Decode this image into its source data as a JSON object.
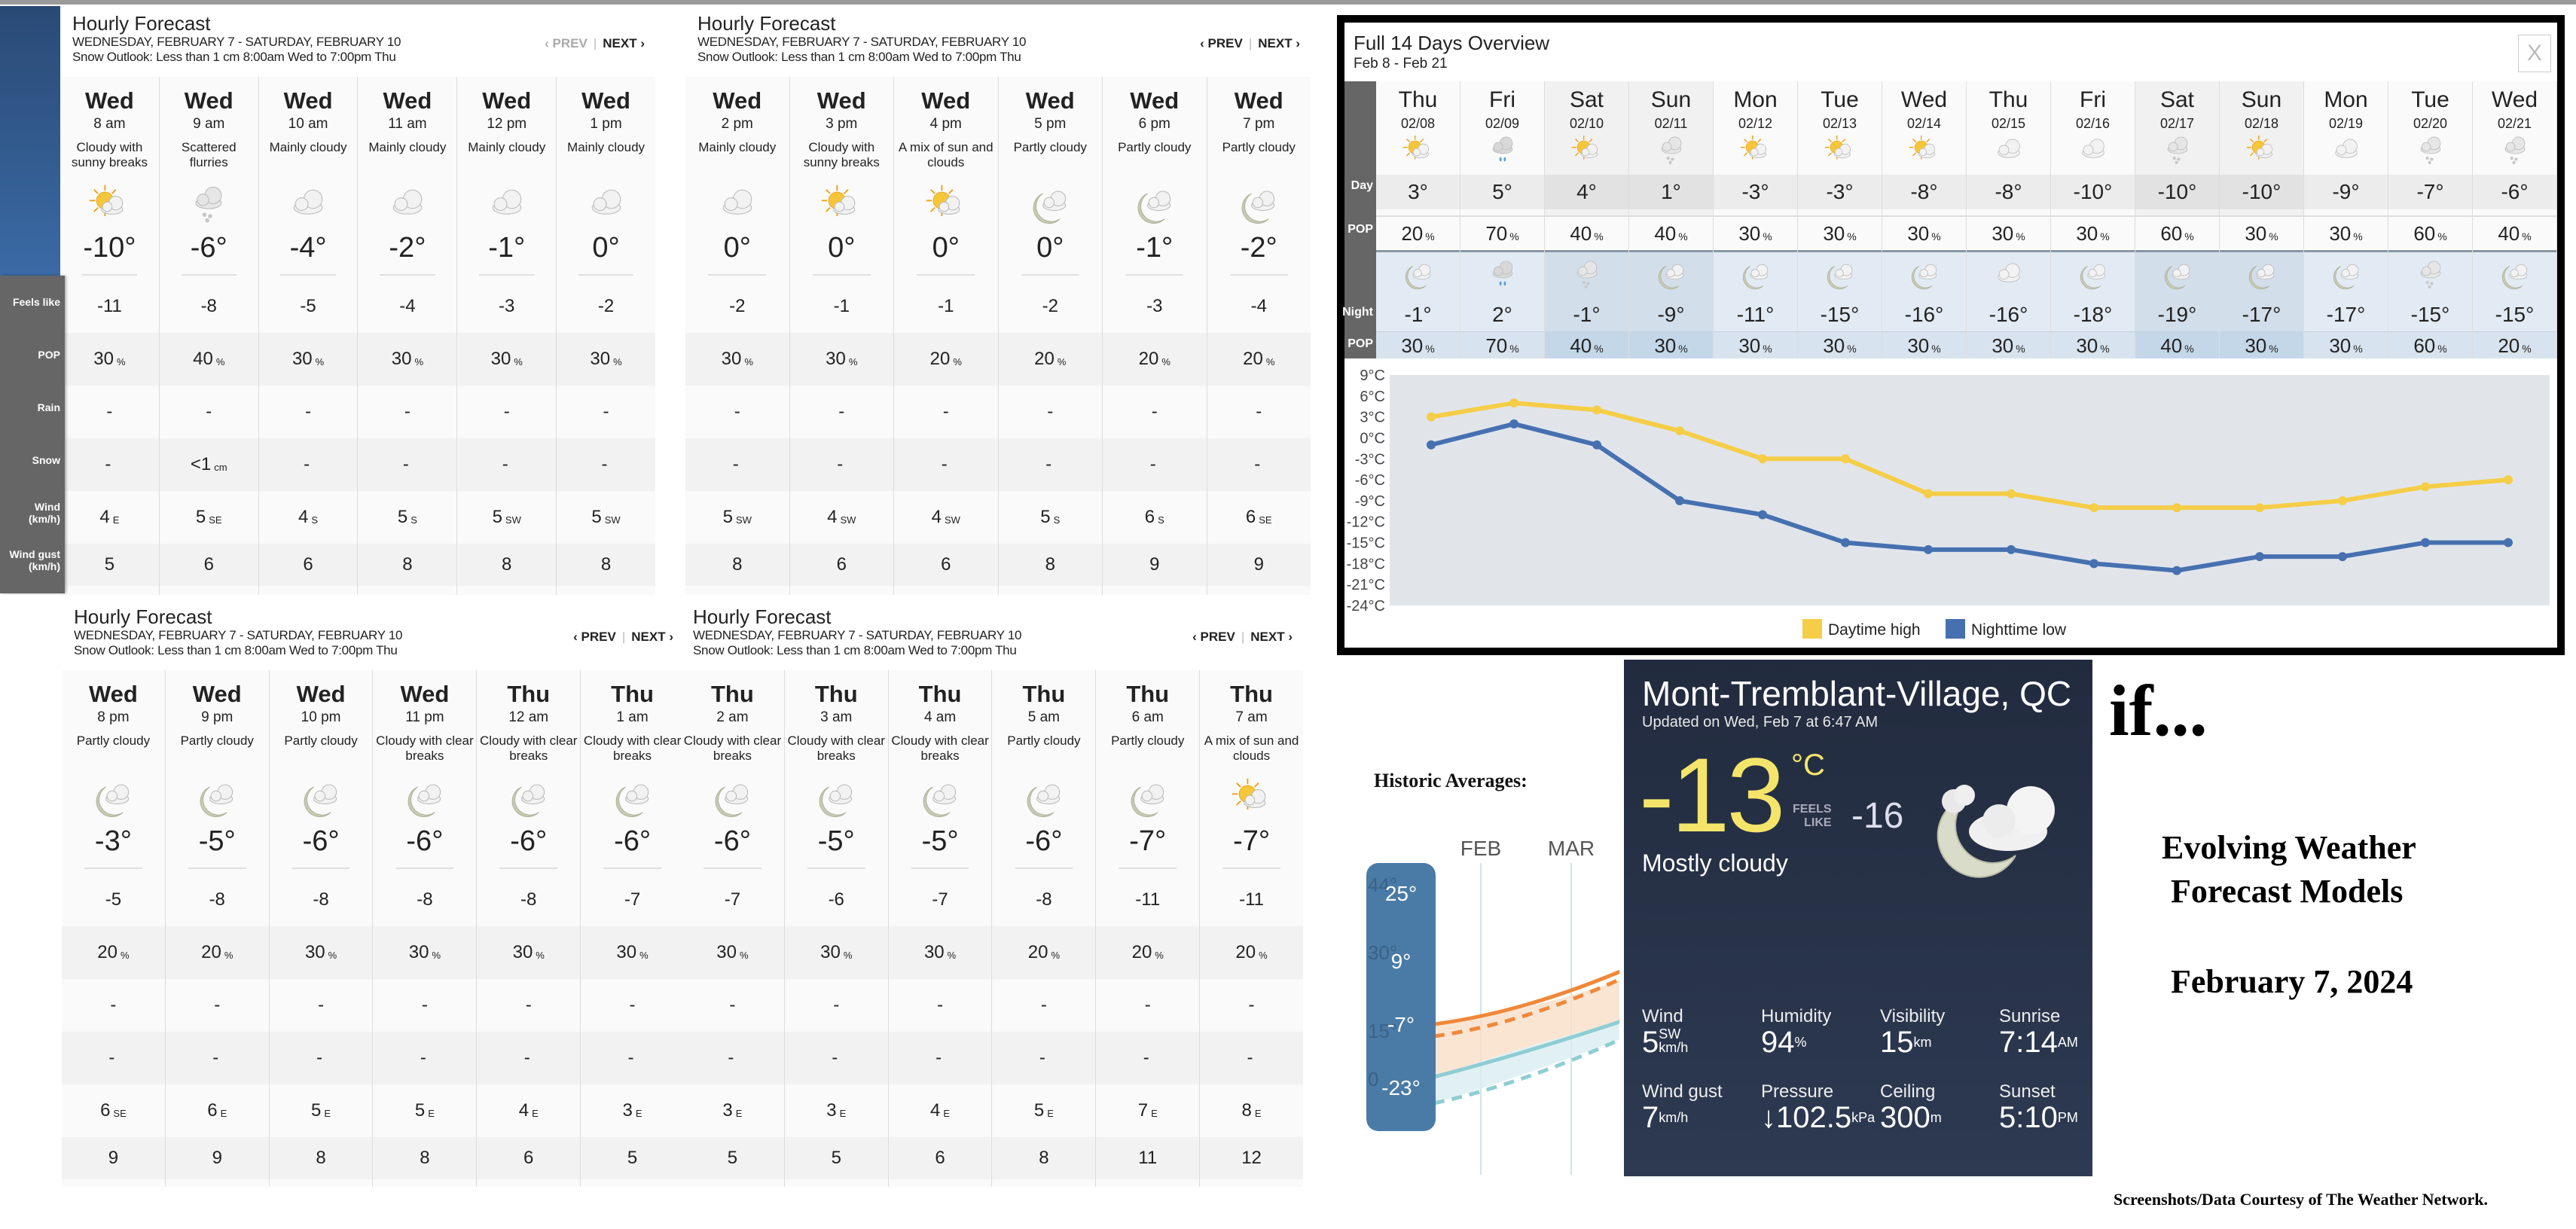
{
  "hourly_panels": [
    {
      "title": "Hourly Forecast",
      "date_range": "WEDNESDAY, FEBRUARY 7 - SATURDAY, FEBRUARY 10",
      "snow_outlook": "Snow Outlook: Less than 1 cm 8:00am Wed to 7:00pm Thu",
      "prev_label": "‹ PREV",
      "next_label": "NEXT ›",
      "prev_disabled": true,
      "hours": [
        {
          "day": "Wed",
          "time": "8 am",
          "condition": "Cloudy with sunny breaks",
          "icon": "sun-cloud",
          "temp": "-10°",
          "feels_like": "-11",
          "pop": "30",
          "rain": "-",
          "snow": "-",
          "snow_unit": "",
          "wind": "4",
          "wind_dir": "E",
          "gust": "5"
        },
        {
          "day": "Wed",
          "time": "9 am",
          "condition": "Scattered flurries",
          "icon": "flurries",
          "temp": "-6°",
          "feels_like": "-8",
          "pop": "40",
          "rain": "-",
          "snow": "<1",
          "snow_unit": "cm",
          "wind": "5",
          "wind_dir": "SE",
          "gust": "6"
        },
        {
          "day": "Wed",
          "time": "10 am",
          "condition": "Mainly cloudy",
          "icon": "cloud",
          "temp": "-4°",
          "feels_like": "-5",
          "pop": "30",
          "rain": "-",
          "snow": "-",
          "snow_unit": "",
          "wind": "4",
          "wind_dir": "S",
          "gust": "6"
        },
        {
          "day": "Wed",
          "time": "11 am",
          "condition": "Mainly cloudy",
          "icon": "cloud",
          "temp": "-2°",
          "feels_like": "-4",
          "pop": "30",
          "rain": "-",
          "snow": "-",
          "snow_unit": "",
          "wind": "5",
          "wind_dir": "S",
          "gust": "8"
        },
        {
          "day": "Wed",
          "time": "12 pm",
          "condition": "Mainly cloudy",
          "icon": "cloud",
          "temp": "-1°",
          "feels_like": "-3",
          "pop": "30",
          "rain": "-",
          "snow": "-",
          "snow_unit": "",
          "wind": "5",
          "wind_dir": "SW",
          "gust": "8"
        },
        {
          "day": "Wed",
          "time": "1 pm",
          "condition": "Mainly cloudy",
          "icon": "cloud",
          "temp": "0°",
          "feels_like": "-2",
          "pop": "30",
          "rain": "-",
          "snow": "-",
          "snow_unit": "",
          "wind": "5",
          "wind_dir": "SW",
          "gust": "8"
        }
      ]
    },
    {
      "title": "Hourly Forecast",
      "date_range": "WEDNESDAY, FEBRUARY 7 - SATURDAY, FEBRUARY 10",
      "snow_outlook": "Snow Outlook: Less than 1 cm 8:00am Wed to 7:00pm Thu",
      "prev_label": "‹ PREV",
      "next_label": "NEXT ›",
      "prev_disabled": false,
      "hours": [
        {
          "day": "Wed",
          "time": "2 pm",
          "condition": "Mainly cloudy",
          "icon": "cloud",
          "temp": "0°",
          "feels_like": "-2",
          "pop": "30",
          "rain": "-",
          "snow": "-",
          "snow_unit": "",
          "wind": "5",
          "wind_dir": "SW",
          "gust": "8"
        },
        {
          "day": "Wed",
          "time": "3 pm",
          "condition": "Cloudy with sunny breaks",
          "icon": "sun-cloud",
          "temp": "0°",
          "feels_like": "-1",
          "pop": "30",
          "rain": "-",
          "snow": "-",
          "snow_unit": "",
          "wind": "4",
          "wind_dir": "SW",
          "gust": "6"
        },
        {
          "day": "Wed",
          "time": "4 pm",
          "condition": "A mix of sun and clouds",
          "icon": "sun-cloud",
          "temp": "0°",
          "feels_like": "-1",
          "pop": "20",
          "rain": "-",
          "snow": "-",
          "snow_unit": "",
          "wind": "4",
          "wind_dir": "SW",
          "gust": "6"
        },
        {
          "day": "Wed",
          "time": "5 pm",
          "condition": "Partly cloudy",
          "icon": "moon-cloud",
          "temp": "0°",
          "feels_like": "-2",
          "pop": "20",
          "rain": "-",
          "snow": "-",
          "snow_unit": "",
          "wind": "5",
          "wind_dir": "S",
          "gust": "8"
        },
        {
          "day": "Wed",
          "time": "6 pm",
          "condition": "Partly cloudy",
          "icon": "moon-cloud",
          "temp": "-1°",
          "feels_like": "-3",
          "pop": "20",
          "rain": "-",
          "snow": "-",
          "snow_unit": "",
          "wind": "6",
          "wind_dir": "S",
          "gust": "9"
        },
        {
          "day": "Wed",
          "time": "7 pm",
          "condition": "Partly cloudy",
          "icon": "moon-cloud",
          "temp": "-2°",
          "feels_like": "-4",
          "pop": "20",
          "rain": "-",
          "snow": "-",
          "snow_unit": "",
          "wind": "6",
          "wind_dir": "SE",
          "gust": "9"
        }
      ]
    },
    {
      "title": "Hourly Forecast",
      "date_range": "WEDNESDAY, FEBRUARY 7 - SATURDAY, FEBRUARY 10",
      "snow_outlook": "Snow Outlook: Less than 1 cm 8:00am Wed to 7:00pm Thu",
      "prev_label": "‹ PREV",
      "next_label": "NEXT ›",
      "prev_disabled": false,
      "hours": [
        {
          "day": "Wed",
          "time": "8 pm",
          "condition": "Partly cloudy",
          "icon": "moon-cloud",
          "temp": "-3°",
          "feels_like": "-5",
          "pop": "20",
          "rain": "-",
          "snow": "-",
          "snow_unit": "",
          "wind": "6",
          "wind_dir": "SE",
          "gust": "9"
        },
        {
          "day": "Wed",
          "time": "9 pm",
          "condition": "Partly cloudy",
          "icon": "moon-cloud",
          "temp": "-5°",
          "feels_like": "-8",
          "pop": "20",
          "rain": "-",
          "snow": "-",
          "snow_unit": "",
          "wind": "6",
          "wind_dir": "E",
          "gust": "9"
        },
        {
          "day": "Wed",
          "time": "10 pm",
          "condition": "Partly cloudy",
          "icon": "moon-cloud",
          "temp": "-6°",
          "feels_like": "-8",
          "pop": "30",
          "rain": "-",
          "snow": "-",
          "snow_unit": "",
          "wind": "5",
          "wind_dir": "E",
          "gust": "8"
        },
        {
          "day": "Wed",
          "time": "11 pm",
          "condition": "Cloudy with clear breaks",
          "icon": "moon-cloud",
          "temp": "-6°",
          "feels_like": "-8",
          "pop": "30",
          "rain": "-",
          "snow": "-",
          "snow_unit": "",
          "wind": "5",
          "wind_dir": "E",
          "gust": "8"
        },
        {
          "day": "Thu",
          "time": "12 am",
          "condition": "Cloudy with clear breaks",
          "icon": "moon-cloud",
          "temp": "-6°",
          "feels_like": "-8",
          "pop": "30",
          "rain": "-",
          "snow": "-",
          "snow_unit": "",
          "wind": "4",
          "wind_dir": "E",
          "gust": "6"
        },
        {
          "day": "Thu",
          "time": "1 am",
          "condition": "Cloudy with clear breaks",
          "icon": "moon-cloud",
          "temp": "-6°",
          "feels_like": "-7",
          "pop": "30",
          "rain": "-",
          "snow": "-",
          "snow_unit": "",
          "wind": "3",
          "wind_dir": "E",
          "gust": "5"
        }
      ]
    },
    {
      "title": "Hourly Forecast",
      "date_range": "WEDNESDAY, FEBRUARY 7 - SATURDAY, FEBRUARY 10",
      "snow_outlook": "Snow Outlook: Less than 1 cm 8:00am Wed to 7:00pm Thu",
      "prev_label": "‹ PREV",
      "next_label": "NEXT ›",
      "prev_disabled": false,
      "hours": [
        {
          "day": "Thu",
          "time": "2 am",
          "condition": "Cloudy with clear breaks",
          "icon": "moon-cloud",
          "temp": "-6°",
          "feels_like": "-7",
          "pop": "30",
          "rain": "-",
          "snow": "-",
          "snow_unit": "",
          "wind": "3",
          "wind_dir": "E",
          "gust": "5"
        },
        {
          "day": "Thu",
          "time": "3 am",
          "condition": "Cloudy with clear breaks",
          "icon": "moon-cloud",
          "temp": "-5°",
          "feels_like": "-6",
          "pop": "30",
          "rain": "-",
          "snow": "-",
          "snow_unit": "",
          "wind": "3",
          "wind_dir": "E",
          "gust": "5"
        },
        {
          "day": "Thu",
          "time": "4 am",
          "condition": "Cloudy with clear breaks",
          "icon": "moon-cloud",
          "temp": "-5°",
          "feels_like": "-7",
          "pop": "30",
          "rain": "-",
          "snow": "-",
          "snow_unit": "",
          "wind": "4",
          "wind_dir": "E",
          "gust": "6"
        },
        {
          "day": "Thu",
          "time": "5 am",
          "condition": "Partly cloudy",
          "icon": "moon-cloud",
          "temp": "-6°",
          "feels_like": "-8",
          "pop": "20",
          "rain": "-",
          "snow": "-",
          "snow_unit": "",
          "wind": "5",
          "wind_dir": "E",
          "gust": "8"
        },
        {
          "day": "Thu",
          "time": "6 am",
          "condition": "Partly cloudy",
          "icon": "moon-cloud",
          "temp": "-7°",
          "feels_like": "-11",
          "pop": "20",
          "rain": "-",
          "snow": "-",
          "snow_unit": "",
          "wind": "7",
          "wind_dir": "E",
          "gust": "11"
        },
        {
          "day": "Thu",
          "time": "7 am",
          "condition": "A mix of sun and clouds",
          "icon": "sun-cloud",
          "temp": "-7°",
          "feels_like": "-11",
          "pop": "20",
          "rain": "-",
          "snow": "-",
          "snow_unit": "",
          "wind": "8",
          "wind_dir": "E",
          "gust": "12"
        }
      ]
    }
  ],
  "row_labels": {
    "feels_like": "Feels like",
    "pop": "POP",
    "rain": "Rain",
    "snow": "Snow",
    "wind": "Wind\n(km/h)",
    "gust": "Wind gust\n(km/h)",
    "pct": "%"
  },
  "overview": {
    "title": "Full 14 Days Overview",
    "subtitle": "Feb 8 - Feb 21",
    "close_label": "X",
    "label_day": "Day",
    "label_pop": "POP",
    "label_night": "Night",
    "label_npop": "POP",
    "days": [
      {
        "dow": "Thu",
        "date": "02/08",
        "day_icon": "sun-cloud",
        "high": "3°",
        "day_pop": "20",
        "night_icon": "moon-cloud",
        "low": "-1°",
        "night_pop": "30",
        "weekend": false
      },
      {
        "dow": "Fri",
        "date": "02/09",
        "day_icon": "rain",
        "high": "5°",
        "day_pop": "70",
        "night_icon": "rain",
        "low": "2°",
        "night_pop": "70",
        "weekend": false
      },
      {
        "dow": "Sat",
        "date": "02/10",
        "day_icon": "sun-cloud",
        "high": "4°",
        "day_pop": "40",
        "night_icon": "flurries",
        "low": "-1°",
        "night_pop": "40",
        "weekend": true
      },
      {
        "dow": "Sun",
        "date": "02/11",
        "day_icon": "flurries",
        "high": "1°",
        "day_pop": "40",
        "night_icon": "moon-cloud",
        "low": "-9°",
        "night_pop": "30",
        "weekend": true
      },
      {
        "dow": "Mon",
        "date": "02/12",
        "day_icon": "sun-cloud",
        "high": "-3°",
        "day_pop": "30",
        "night_icon": "moon-cloud",
        "low": "-11°",
        "night_pop": "30",
        "weekend": false
      },
      {
        "dow": "Tue",
        "date": "02/13",
        "day_icon": "sun-cloud",
        "high": "-3°",
        "day_pop": "30",
        "night_icon": "moon-cloud",
        "low": "-15°",
        "night_pop": "30",
        "weekend": false
      },
      {
        "dow": "Wed",
        "date": "02/14",
        "day_icon": "sun-cloud",
        "high": "-8°",
        "day_pop": "30",
        "night_icon": "moon-cloud",
        "low": "-16°",
        "night_pop": "30",
        "weekend": false
      },
      {
        "dow": "Thu",
        "date": "02/15",
        "day_icon": "cloud",
        "high": "-8°",
        "day_pop": "30",
        "night_icon": "cloud",
        "low": "-16°",
        "night_pop": "30",
        "weekend": false
      },
      {
        "dow": "Fri",
        "date": "02/16",
        "day_icon": "cloud",
        "high": "-10°",
        "day_pop": "30",
        "night_icon": "moon-cloud",
        "low": "-18°",
        "night_pop": "30",
        "weekend": false
      },
      {
        "dow": "Sat",
        "date": "02/17",
        "day_icon": "flurries",
        "high": "-10°",
        "day_pop": "60",
        "night_icon": "moon-cloud",
        "low": "-19°",
        "night_pop": "40",
        "weekend": true
      },
      {
        "dow": "Sun",
        "date": "02/18",
        "day_icon": "sun-cloud",
        "high": "-10°",
        "day_pop": "30",
        "night_icon": "moon-cloud",
        "low": "-17°",
        "night_pop": "30",
        "weekend": true
      },
      {
        "dow": "Mon",
        "date": "02/19",
        "day_icon": "cloud",
        "high": "-9°",
        "day_pop": "30",
        "night_icon": "moon-cloud",
        "low": "-17°",
        "night_pop": "30",
        "weekend": false
      },
      {
        "dow": "Tue",
        "date": "02/20",
        "day_icon": "flurries",
        "high": "-7°",
        "day_pop": "60",
        "night_icon": "flurries",
        "low": "-15°",
        "night_pop": "60",
        "weekend": false
      },
      {
        "dow": "Wed",
        "date": "02/21",
        "day_icon": "flurries",
        "high": "-6°",
        "day_pop": "40",
        "night_icon": "moon-cloud",
        "low": "-15°",
        "night_pop": "20",
        "weekend": false
      }
    ]
  },
  "chart_data": {
    "type": "line",
    "title": "",
    "xlabel": "",
    "ylabel": "",
    "x": [
      "02/08",
      "02/09",
      "02/10",
      "02/11",
      "02/12",
      "02/13",
      "02/14",
      "02/15",
      "02/16",
      "02/17",
      "02/18",
      "02/19",
      "02/20",
      "02/21"
    ],
    "ylim": [
      -24,
      9
    ],
    "yticks": [
      9,
      6,
      3,
      0,
      -3,
      -6,
      -9,
      -12,
      -15,
      -18,
      -21,
      -24
    ],
    "ytick_labels": [
      "9°C",
      "6°C",
      "3°C",
      "0°C",
      "-3°C",
      "-6°C",
      "-9°C",
      "-12°C",
      "-15°C",
      "-18°C",
      "-21°C",
      "-24°C"
    ],
    "grid": false,
    "legend_position": "bottom-center",
    "series": [
      {
        "name": "Daytime high",
        "color": "#f5cd47",
        "values": [
          3,
          5,
          4,
          1,
          -3,
          -3,
          -8,
          -8,
          -10,
          -10,
          -10,
          -9,
          -7,
          -6
        ]
      },
      {
        "name": "Nighttime low",
        "color": "#4670b0",
        "values": [
          -1,
          2,
          -1,
          -9,
          -11,
          -15,
          -16,
          -16,
          -18,
          -19,
          -17,
          -17,
          -15,
          -15
        ]
      }
    ]
  },
  "historic": {
    "title": "Historic Averages:",
    "months": [
      "FEB",
      "MAR"
    ],
    "scale_labels": [
      "25°",
      "9°",
      "-7°",
      "-23°"
    ],
    "faded_labels": [
      "44°",
      "30°",
      "15°",
      "0"
    ],
    "colors": {
      "high": "#f0883a",
      "low": "#8ecdd3",
      "scale_bg": "#4a7ba6"
    }
  },
  "current": {
    "location": "Mont-Tremblant-Village, QC",
    "updated": "Updated on Wed, Feb 7 at 6:47 AM",
    "temp": "-13",
    "temp_unit": "°C",
    "feels_label_1": "FEELS",
    "feels_label_2": "LIKE",
    "feels_like": "-16",
    "condition": "Mostly cloudy",
    "icon": "moon-cloud",
    "stats": [
      {
        "label": "Wind",
        "value": "5",
        "unit_top": "SW",
        "unit_bottom": "km/h"
      },
      {
        "label": "Humidity",
        "value": "94",
        "unit_top": "%",
        "unit_bottom": ""
      },
      {
        "label": "Visibility",
        "value": "15",
        "unit_top": "km",
        "unit_bottom": ""
      },
      {
        "label": "Sunrise",
        "value": "7:14",
        "unit_top": "AM",
        "unit_bottom": ""
      },
      {
        "label": "Wind gust",
        "value": "7",
        "unit_top": "km/h",
        "unit_bottom": ""
      },
      {
        "label": "Pressure",
        "value": "↓102.5",
        "unit_top": "kPa",
        "unit_bottom": ""
      },
      {
        "label": "Ceiling",
        "value": "300",
        "unit_top": "m",
        "unit_bottom": ""
      },
      {
        "label": "Sunset",
        "value": "5:10",
        "unit_top": "PM",
        "unit_bottom": ""
      }
    ]
  },
  "annotation": {
    "if_text": "if...",
    "headline_1": "Evolving Weather",
    "headline_2": "Forecast Models",
    "date": "February 7, 2024",
    "credit": "Screenshots/Data Courtesy of The Weather Network."
  }
}
